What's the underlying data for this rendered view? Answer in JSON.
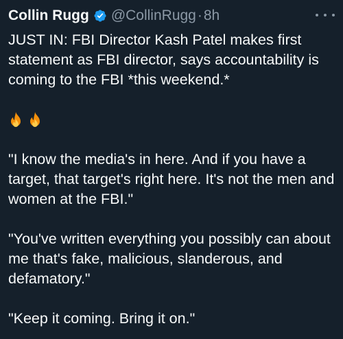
{
  "tweet": {
    "author_name": "Collin Rugg",
    "handle": "@CollinRugg",
    "separator": "·",
    "time": "8h",
    "verified_icon": "verified-badge-icon",
    "more_icon": "more-options-icon",
    "paragraphs": [
      "JUST IN: FBI Director Kash Patel makes first statement as FBI director, says accountability is coming to the FBI *this weekend.*",
      "\"I know the media's in here. And if you have a target, that target's right here. It's not the men and women at the FBI.\"",
      "\"You've written everything you possibly can about me that's fake, malicious, slanderous, and defamatory.\"",
      "\"Keep it coming. Bring it on.\""
    ],
    "emoji": [
      "fire-emoji",
      "fire-emoji"
    ]
  },
  "colors": {
    "background": "#15202b",
    "text": "#f7f9f9",
    "muted": "#8b98a5",
    "verified": "#1d9bf0"
  }
}
